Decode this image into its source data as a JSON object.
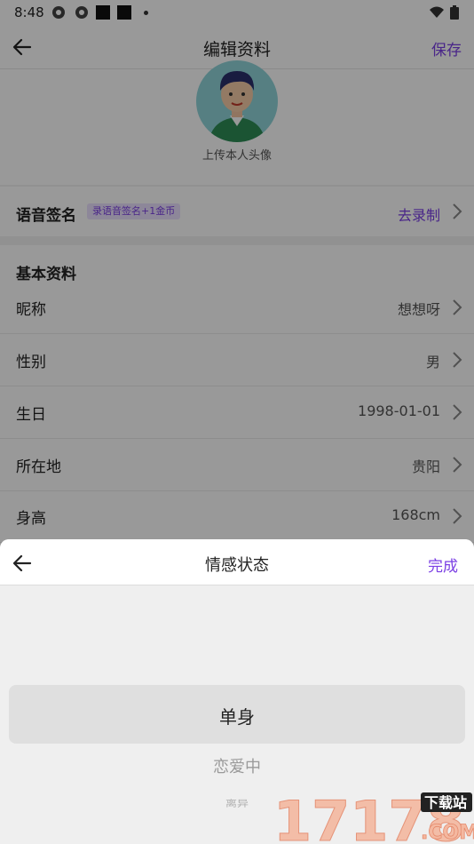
{
  "status_bar": {
    "time": "8:48"
  },
  "header": {
    "title": "编辑资料",
    "save_label": "保存"
  },
  "avatar": {
    "caption": "上传本人头像"
  },
  "voice_signature": {
    "label": "语音签名",
    "badge": "录语音签名+1金币",
    "action": "去录制"
  },
  "basic_info": {
    "title": "基本资料",
    "rows": [
      {
        "label": "昵称",
        "value": "想想呀"
      },
      {
        "label": "性别",
        "value": "男"
      },
      {
        "label": "生日",
        "value": "1998-01-01"
      },
      {
        "label": "所在地",
        "value": "贵阳"
      },
      {
        "label": "身高",
        "value": "168cm"
      }
    ]
  },
  "sheet": {
    "title": "情感状态",
    "done_label": "完成",
    "options": [
      "单身",
      "恋爱中",
      "离异"
    ],
    "selected": "单身"
  },
  "watermark": {
    "number": "17178",
    "tag": "下载站",
    "suffix": ".COM"
  },
  "colors": {
    "accent": "#7b3fe4",
    "overlay": "rgba(0,0,0,0.40)",
    "badge_bg": "#ece2ff",
    "sheet_bg": "#efefef"
  }
}
